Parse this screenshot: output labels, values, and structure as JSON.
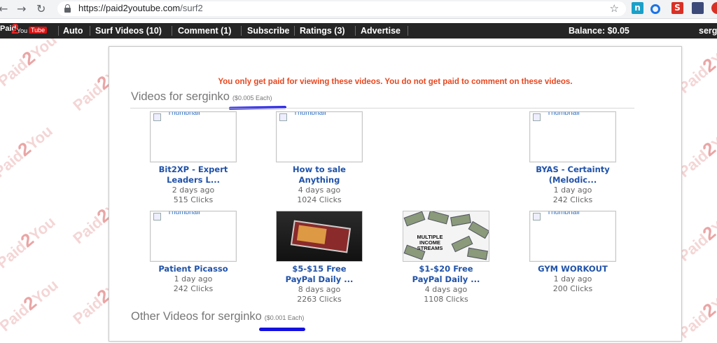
{
  "browser": {
    "url_host": "https://paid2youtube.com",
    "url_path": "/surf2"
  },
  "watermark": {
    "text_a": "Paid",
    "text_b": "2",
    "text_c": "You",
    "text_d": "Tube"
  },
  "site": {
    "logo": {
      "paid": "Paid",
      "two": "2",
      "you": "You",
      "tube": "Tube"
    },
    "nav": [
      {
        "label": "Auto"
      },
      {
        "label": "Surf Videos (10)"
      },
      {
        "label": "Comment (1)"
      },
      {
        "label": "Subscribe"
      },
      {
        "label": "Ratings (3)"
      },
      {
        "label": "Advertise"
      }
    ],
    "balance": "Balance: $0.05",
    "user": "serg"
  },
  "main": {
    "notice": "You only get paid for viewing these videos. You do not get paid to comment on these videos.",
    "section1": {
      "title": "Videos for serginko",
      "price": "($0.005 Each)"
    },
    "section2": {
      "title": "Other Videos for serginko",
      "price": "($0.001 Each)"
    },
    "thumb_alt": "Thumbnail",
    "videos": [
      {
        "title_l1": "Bit2XP - Expert",
        "title_l2": "Leaders L...",
        "age": "2 days ago",
        "clicks": "515 Clicks",
        "thumb": "broken"
      },
      {
        "title_l1": "How to sale",
        "title_l2": "Anything",
        "age": "4 days ago",
        "clicks": "1024 Clicks",
        "thumb": "broken"
      },
      {
        "title_l1": "BYAS - Certainty",
        "title_l2": "(Melodic...",
        "age": "1 day ago",
        "clicks": "242 Clicks",
        "thumb": "broken"
      },
      {
        "title_l1": "Patient Picasso",
        "title_l2": "",
        "age": "1 day ago",
        "clicks": "242 Clicks",
        "thumb": "broken"
      },
      {
        "title_l1": "$5-$15 Free",
        "title_l2": "PayPal Daily ...",
        "age": "8 days ago",
        "clicks": "2263 Clicks",
        "thumb": "phone-image"
      },
      {
        "title_l1": "$1-$20 Free",
        "title_l2": "PayPal Daily ...",
        "age": "4 days ago",
        "clicks": "1108 Clicks",
        "thumb": "money-image",
        "thumb_text": "MULTIPLE INCOME STREAMS"
      },
      {
        "title_l1": "GYM WORKOUT",
        "title_l2": "",
        "age": "1 day ago",
        "clicks": "200 Clicks",
        "thumb": "broken"
      }
    ]
  },
  "colors": {
    "notice": "#e8471f",
    "link": "#2052a8",
    "navbar": "#252525",
    "marker": "#1410e0"
  }
}
